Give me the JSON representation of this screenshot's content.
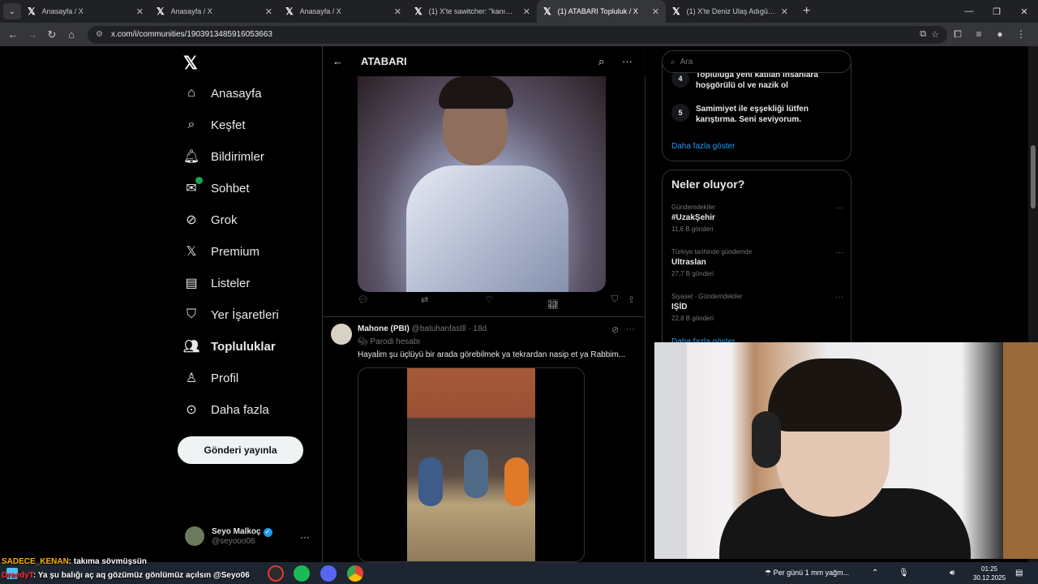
{
  "browser": {
    "tabs": [
      {
        "title": "Anasayfa / X",
        "active": false
      },
      {
        "title": "Anasayfa / X",
        "active": false
      },
      {
        "title": "Anasayfa / X",
        "active": false
      },
      {
        "title": "(1) X'te sawitcher: \"kanım dond",
        "active": false
      },
      {
        "title": "(1) ATABARI Topluluk / X",
        "active": true
      },
      {
        "title": "(1) X'te Deniz Ulaş Adıgüzel: \"",
        "active": false
      }
    ],
    "url": "x.com/i/communities/1903913485916053663"
  },
  "nav": {
    "items": [
      {
        "label": "Anasayfa",
        "icon": "home-icon"
      },
      {
        "label": "Keşfet",
        "icon": "search-icon"
      },
      {
        "label": "Bildirimler",
        "icon": "bell-icon"
      },
      {
        "label": "Sohbet",
        "icon": "mail-icon"
      },
      {
        "label": "Grok",
        "icon": "grok-icon"
      },
      {
        "label": "Premium",
        "icon": "x-icon"
      },
      {
        "label": "Listeler",
        "icon": "list-icon"
      },
      {
        "label": "Yer İşaretleri",
        "icon": "bookmark-icon"
      },
      {
        "label": "Topluluklar",
        "icon": "people-icon"
      },
      {
        "label": "Profil",
        "icon": "person-icon"
      },
      {
        "label": "Daha fazla",
        "icon": "more-circle-icon"
      }
    ],
    "post_button": "Gönderi yayınla",
    "account": {
      "name": "Seyo Malkoç",
      "handle": "@seyooo06"
    }
  },
  "main": {
    "title": "ATABARI",
    "tweet1": {
      "views": "20"
    },
    "tweet2": {
      "name": "Mahone (PBI)",
      "handle": "@batuhanfastll",
      "time": "· 18d",
      "parody": "Parodi hesabı",
      "text": "Hayalim şu üçlüyü bir arada görebilmek ya tekrardan nasip et ya Rabbim..."
    }
  },
  "sidebar": {
    "search_placeholder": "Ara",
    "rules": [
      {
        "num": "4",
        "text": "Topluluğa yeni katılan insanlara hoşgörülü ol ve nazik ol"
      },
      {
        "num": "5",
        "text": "Samimiyet ile eşşekliği lütfen karıştırma. Seni seviyorum."
      }
    ],
    "rules_show_more": "Daha fazla göster",
    "trends_title": "Neler oluyor?",
    "trends": [
      {
        "category": "Gündemdekiler",
        "name": "#UzakŞehir",
        "count": "11,6 B gönderi"
      },
      {
        "category": "Türkiye tarihinde gündemde",
        "name": "Ultraslan",
        "count": "27,7 B gönderi"
      },
      {
        "category": "Siyaset · Gündemdekiler",
        "name": "IŞİD",
        "count": "22,8 B gönderi"
      }
    ],
    "trends_show_more": "Daha fazla göster"
  },
  "chat": [
    {
      "user": "SADECE_KENAN",
      "message": ": takıma sövmüşsün"
    },
    {
      "user": "DreedyT",
      "message": ": Ya şu balığı aç aq gözümüz gönlümüz açılsın @Seyo06"
    }
  ],
  "taskbar": {
    "weather": "Per günü 1 mm yağm...",
    "time": "01:25",
    "date": "30.12.2025"
  },
  "colors": {
    "accent": "#1d9bf0",
    "background": "#000000",
    "border": "#2f3336"
  }
}
